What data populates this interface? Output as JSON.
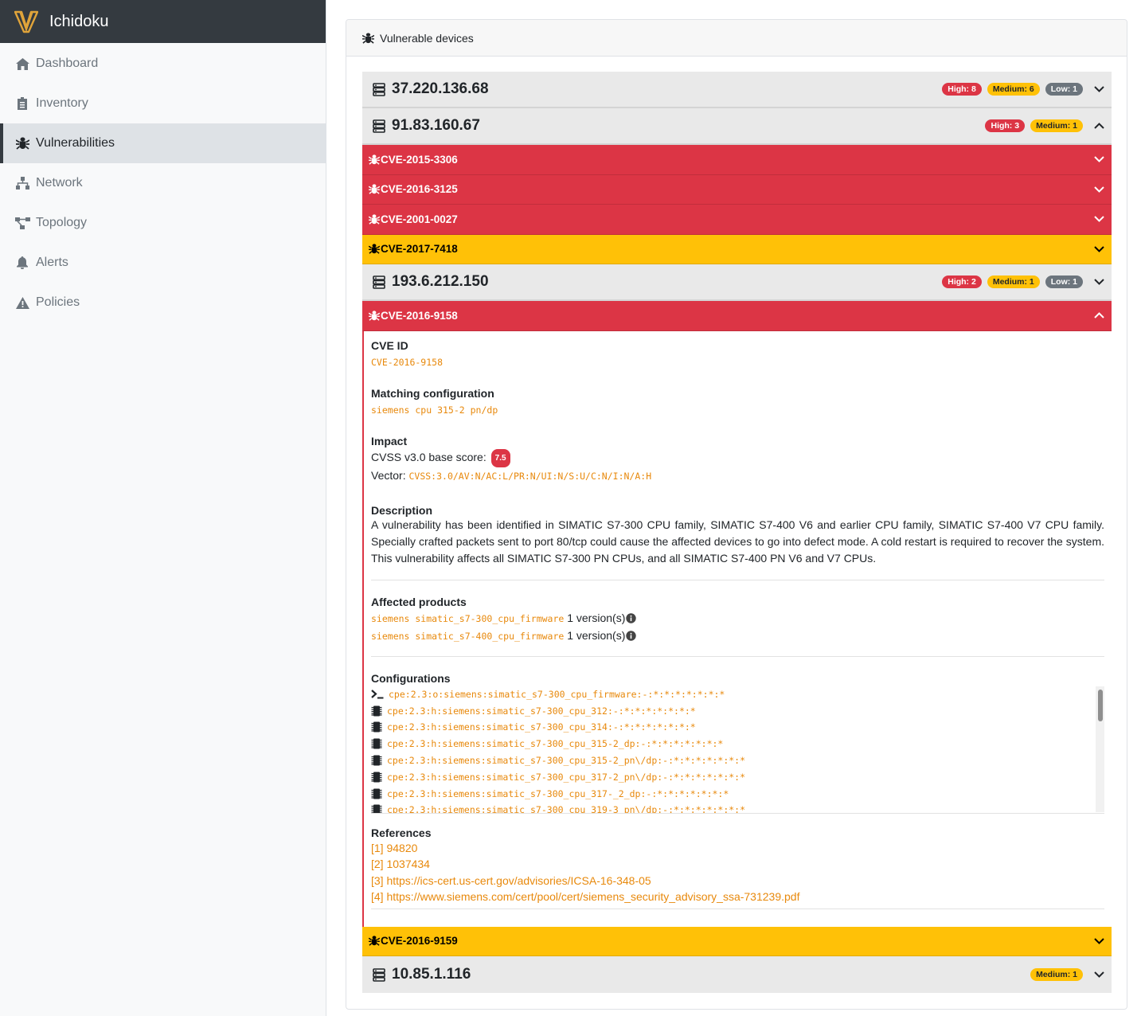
{
  "app": {
    "title": "Ichidoku"
  },
  "sidebar": {
    "items": [
      {
        "label": "Dashboard",
        "icon": "home-icon"
      },
      {
        "label": "Inventory",
        "icon": "clipboard-icon"
      },
      {
        "label": "Vulnerabilities",
        "icon": "bug-icon",
        "active": true
      },
      {
        "label": "Network",
        "icon": "network-icon"
      },
      {
        "label": "Topology",
        "icon": "topology-icon"
      },
      {
        "label": "Alerts",
        "icon": "bell-icon"
      },
      {
        "label": "Policies",
        "icon": "warning-icon"
      }
    ]
  },
  "card": {
    "title": "Vulnerable devices"
  },
  "colors": {
    "high": "#dc3545",
    "medium": "#ffc107",
    "low": "#6c757d",
    "link": "#e8890c",
    "nav_dark": "#343a40"
  },
  "devices": [
    {
      "ip": "37.220.136.68",
      "high": "High: 8",
      "medium": "Medium: 6",
      "low": "Low: 1"
    },
    {
      "ip": "91.83.160.67",
      "high": "High: 3",
      "medium": "Medium: 1",
      "cves": [
        "CVE-2015-3306",
        "CVE-2016-3125",
        "CVE-2001-0027",
        "CVE-2017-7418"
      ]
    },
    {
      "ip": "193.6.212.150",
      "high": "High: 2",
      "medium": "Medium: 1",
      "low": "Low: 1",
      "cves": [
        "CVE-2016-9158",
        "CVE-2016-9159"
      ]
    },
    {
      "ip": "10.85.1.116",
      "medium": "Medium: 1"
    }
  ],
  "detail": {
    "cve_id_label": "CVE ID",
    "cve_id": "CVE-2016-9158",
    "matching_label": "Matching configuration",
    "matching": "siemens cpu 315-2 pn/dp",
    "impact_label": "Impact",
    "cvss_label": "CVSS v3.0 base score:",
    "cvss_score": "7.5",
    "vector_label": "Vector:",
    "vector": "CVSS:3.0/AV:N/AC:L/PR:N/UI:N/S:U/C:N/I:N/A:H",
    "description_label": "Description",
    "description": "A vulnerability has been identified in SIMATIC S7-300 CPU family, SIMATIC S7-400 V6 and earlier CPU family, SIMATIC S7-400 V7 CPU family. Specially crafted packets sent to port 80/tcp could cause the affected devices to go into defect mode. A cold restart is required to recover the system. This vulnerability affects all SIMATIC S7-300 PN CPUs, and all SIMATIC S7-400 PN V6 and V7 CPUs.",
    "affected_label": "Affected products",
    "affected": [
      {
        "product": "siemens simatic_s7-300_cpu_firmware",
        "versions": "1 version(s)"
      },
      {
        "product": "siemens simatic_s7-400_cpu_firmware",
        "versions": "1 version(s)"
      }
    ],
    "configurations_label": "Configurations",
    "configurations": [
      {
        "type": "os",
        "cpe": "cpe:2.3:o:siemens:simatic_s7-300_cpu_firmware:-:*:*:*:*:*:*:*"
      },
      {
        "type": "hw",
        "cpe": "cpe:2.3:h:siemens:simatic_s7-300_cpu_312:-:*:*:*:*:*:*:*"
      },
      {
        "type": "hw",
        "cpe": "cpe:2.3:h:siemens:simatic_s7-300_cpu_314:-:*:*:*:*:*:*:*"
      },
      {
        "type": "hw",
        "cpe": "cpe:2.3:h:siemens:simatic_s7-300_cpu_315-2_dp:-:*:*:*:*:*:*:*"
      },
      {
        "type": "hw",
        "cpe": "cpe:2.3:h:siemens:simatic_s7-300_cpu_315-2_pn\\/dp:-:*:*:*:*:*:*:*"
      },
      {
        "type": "hw",
        "cpe": "cpe:2.3:h:siemens:simatic_s7-300_cpu_317-2_pn\\/dp:-:*:*:*:*:*:*:*"
      },
      {
        "type": "hw",
        "cpe": "cpe:2.3:h:siemens:simatic_s7-300_cpu_317-_2_dp:-:*:*:*:*:*:*:*"
      },
      {
        "type": "hw",
        "cpe": "cpe:2.3:h:siemens:simatic_s7-300_cpu_319-3_pn\\/dp:-:*:*:*:*:*:*:*"
      }
    ],
    "references_label": "References",
    "references": [
      "[1] 94820",
      "[2] 1037434",
      "[3] https://ics-cert.us-cert.gov/advisories/ICSA-16-348-05",
      "[4] https://www.siemens.com/cert/pool/cert/siemens_security_advisory_ssa-731239.pdf"
    ]
  }
}
